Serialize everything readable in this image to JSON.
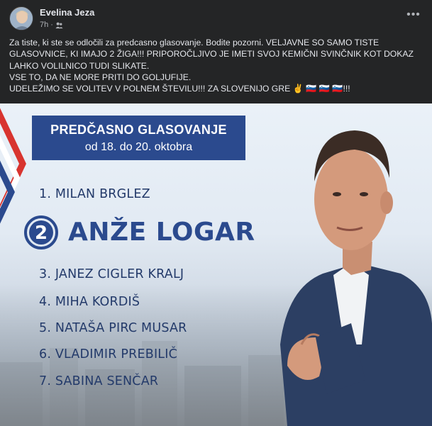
{
  "post": {
    "author": "Evelina Jeza",
    "time": "7h",
    "audience_icon": "friends-icon",
    "more_icon": "more-options-icon",
    "more_glyph": "•••",
    "text_lines": [
      "Za tiste, ki ste se odločili za predcasno glasovanje. Bodite pozorni. VELJAVNE SO SAMO TISTE",
      "GLASOVNICE, KI IMAJO 2 ŽIGA!!! PRIPOROČLJIVO JE IMETI SVOJ KEMIČNI SVINČNIK KOT DOKAZ",
      "LAHKO VOLILNICO TUDI SLIKATE.",
      "VSE TO, DA NE MORE PRITI DO GOLJUFIJE.",
      "UDELEŽIMO SE VOLITEV V POLNEM ŠTEVILU!!! ZA SLOVENIJO GRE ✌ 🇸🇮 🇸🇮 🇸🇮!!!"
    ]
  },
  "image": {
    "banner_title": "PREDČASNO GLASOVANJE",
    "banner_subtitle": "od 18. do 20. oktobra",
    "highlight_number": "2",
    "highlight_name": "ANŽE LOGAR",
    "candidates": [
      "1. MILAN BRGLEZ",
      "3. JANEZ CIGLER KRALJ",
      "4. MIHA KORDIŠ",
      "5. NATAŠA PIRC MUSAR",
      "6. VLADIMIR PREBILIČ",
      "7. SABINA SENČAR"
    ],
    "colors": {
      "navy": "#2b4a8e",
      "red": "#d8342f",
      "text_dark": "#233a6a"
    }
  }
}
